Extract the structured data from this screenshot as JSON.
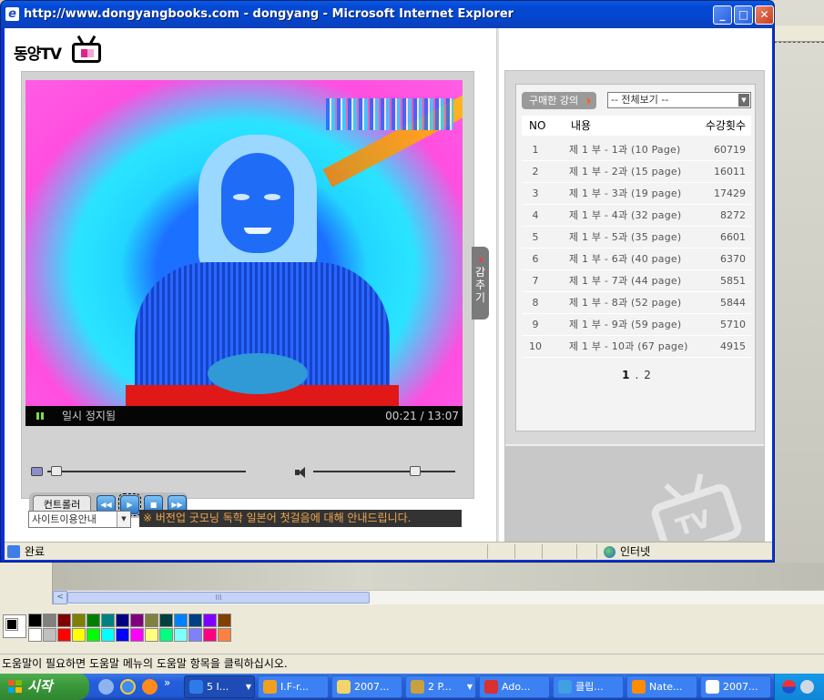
{
  "window": {
    "title": "http://www.dongyangbooks.com - dongyang - Microsoft Internet Explorer",
    "minimize": "_",
    "maximize": "□",
    "close": "✕",
    "status_text": "완료",
    "zone_text": "인터넷"
  },
  "brand": {
    "logo_text": "동양TV"
  },
  "player": {
    "status": "일시 정지됨",
    "time": "00:21 / 13:07",
    "progress_fraction": 0.027,
    "volume_fraction": 0.72,
    "controller_label": "컨트롤러",
    "controls": [
      {
        "name": "rewind",
        "glyph": "◀◀"
      },
      {
        "name": "play",
        "glyph": "▶"
      },
      {
        "name": "stop",
        "glyph": "■"
      },
      {
        "name": "fast-forward",
        "glyph": "▶▶"
      }
    ]
  },
  "site_guide": {
    "selected": "사이트이용안내"
  },
  "notice": "※ 버전업 굿모닝 독학 일본어 첫걸음에 대해 안내드립니다.",
  "hide_tab": {
    "chars": [
      "감",
      "추",
      "기"
    ]
  },
  "lecture_list": {
    "purchased_label": "구매한 강의",
    "filter_selected": "-- 전체보기 --",
    "headers": {
      "no": "NO",
      "title": "내용",
      "views": "수강횟수"
    },
    "rows": [
      {
        "no": "1",
        "title": "제 1 부 - 1과 (10 Page)",
        "views": "60719"
      },
      {
        "no": "2",
        "title": "제 1 부 - 2과 (15 page)",
        "views": "16011"
      },
      {
        "no": "3",
        "title": "제 1 부 - 3과 (19 page)",
        "views": "17429"
      },
      {
        "no": "4",
        "title": "제 1 부 - 4과 (32 page)",
        "views": "8272"
      },
      {
        "no": "5",
        "title": "제 1 부 - 5과 (35 page)",
        "views": "6601"
      },
      {
        "no": "6",
        "title": "제 1 부 - 6과 (40 page)",
        "views": "6370"
      },
      {
        "no": "7",
        "title": "제 1 부 - 7과 (44 page)",
        "views": "5851"
      },
      {
        "no": "8",
        "title": "제 1 부 - 8과 (52 page)",
        "views": "5844"
      },
      {
        "no": "9",
        "title": "제 1 부 - 9과 (59 page)",
        "views": "5710"
      },
      {
        "no": "10",
        "title": "제 1 부 - 10과 (67 page)",
        "views": "4915"
      }
    ],
    "pages": [
      "1",
      ".",
      "2"
    ],
    "watermark": "TV"
  },
  "paint": {
    "status": "도움말이 필요하면 도움말 메뉴의 도움말 항목을 클릭하십시오.",
    "scroll_arrow": "<",
    "scroll_grip": "III",
    "palette": [
      "#000000",
      "#808080",
      "#800000",
      "#808000",
      "#008000",
      "#008080",
      "#000080",
      "#800080",
      "#808040",
      "#004040",
      "#0080ff",
      "#004080",
      "#8000ff",
      "#804000",
      "#ffffff",
      "#c0c0c0",
      "#ff0000",
      "#ffff00",
      "#00ff00",
      "#00ffff",
      "#0000ff",
      "#ff00ff",
      "#ffff80",
      "#00ff80",
      "#80ffff",
      "#8080ff",
      "#ff0080",
      "#ff8040"
    ]
  },
  "taskbar": {
    "start_label": "시작",
    "chevron": "»",
    "tasks": [
      {
        "label": "5 I...",
        "icon_color": "#2d7be6",
        "active": true,
        "has_menu": true
      },
      {
        "label": "I.F-r...",
        "icon_color": "#f0a020",
        "active": false,
        "has_menu": false
      },
      {
        "label": "2007...",
        "icon_color": "#f3d36a",
        "active": false,
        "has_menu": false
      },
      {
        "label": "2 P...",
        "icon_color": "#c9a040",
        "active": false,
        "has_menu": true
      },
      {
        "label": "Ado...",
        "icon_color": "#d93030",
        "active": false,
        "has_menu": false
      },
      {
        "label": "클립...",
        "icon_color": "#40a0e0",
        "active": false,
        "has_menu": false
      },
      {
        "label": "Nate...",
        "icon_color": "#ff8c00",
        "active": false,
        "has_menu": false
      },
      {
        "label": "2007...",
        "icon_color": "#ffffff",
        "active": false,
        "has_menu": false
      }
    ],
    "dropdown_glyph": "▼"
  }
}
